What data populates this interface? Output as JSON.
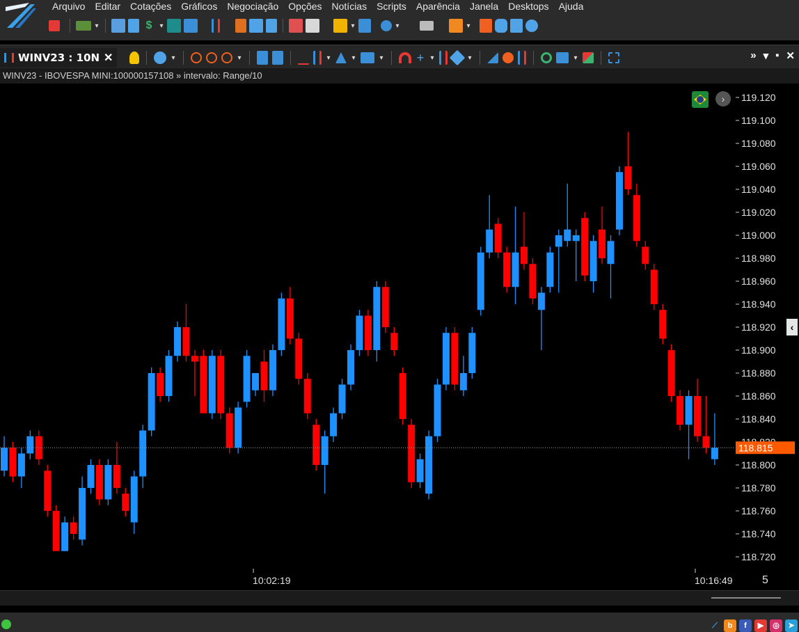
{
  "menu": [
    "Arquivo",
    "Editar",
    "Cotações",
    "Gráficos",
    "Negociação",
    "Opções",
    "Notícias",
    "Scripts",
    "Aparência",
    "Janela",
    "Desktops",
    "Ajuda"
  ],
  "tab": {
    "label": "WINV23 : 10N",
    "close": "✕"
  },
  "info_line": "WINV23 - IBOVESPA MINI:100000157108 » intervalo: Range/10",
  "window_controls": [
    "»",
    "▾",
    "▪",
    "✕"
  ],
  "nav_button": "›",
  "collapse_button": "‹",
  "colors": {
    "up": "#1e90ff",
    "down": "#ff0000",
    "price_tag": "#ff5a00",
    "axis_text": "#e0e0e0",
    "background": "#000000"
  },
  "chart_data": {
    "type": "candlestick",
    "y_axis_ticks": [
      "119.120",
      "119.100",
      "119.080",
      "119.060",
      "119.040",
      "119.020",
      "119.000",
      "118.980",
      "118.960",
      "118.940",
      "118.920",
      "118.900",
      "118.880",
      "118.860",
      "118.840",
      "118.820",
      "118.800",
      "118.780",
      "118.760",
      "118.740",
      "118.720"
    ],
    "ylim": [
      118.71,
      119.125
    ],
    "current_price": "118.815",
    "time_labels": [
      {
        "label": "10:02:19",
        "bar_index": 29
      },
      {
        "label": "10:16:49",
        "bar_index": 80
      }
    ],
    "bar_count_label": "5",
    "candles": [
      {
        "o": 118.795,
        "c": 118.815,
        "h": 118.825,
        "l": 118.79
      },
      {
        "o": 118.815,
        "c": 118.79,
        "h": 118.82,
        "l": 118.785
      },
      {
        "o": 118.79,
        "c": 118.81,
        "h": 118.815,
        "l": 118.78
      },
      {
        "o": 118.81,
        "c": 118.825,
        "h": 118.83,
        "l": 118.805
      },
      {
        "o": 118.825,
        "c": 118.805,
        "h": 118.83,
        "l": 118.8
      },
      {
        "o": 118.795,
        "c": 118.76,
        "h": 118.8,
        "l": 118.755
      },
      {
        "o": 118.76,
        "c": 118.725,
        "h": 118.765,
        "l": 118.725
      },
      {
        "o": 118.725,
        "c": 118.75,
        "h": 118.755,
        "l": 118.725
      },
      {
        "o": 118.75,
        "c": 118.74,
        "h": 118.755,
        "l": 118.735
      },
      {
        "o": 118.735,
        "c": 118.78,
        "h": 118.79,
        "l": 118.73
      },
      {
        "o": 118.78,
        "c": 118.8,
        "h": 118.805,
        "l": 118.775
      },
      {
        "o": 118.8,
        "c": 118.77,
        "h": 118.805,
        "l": 118.765
      },
      {
        "o": 118.77,
        "c": 118.8,
        "h": 118.805,
        "l": 118.765
      },
      {
        "o": 118.8,
        "c": 118.78,
        "h": 118.82,
        "l": 118.775
      },
      {
        "o": 118.775,
        "c": 118.76,
        "h": 118.78,
        "l": 118.755
      },
      {
        "o": 118.75,
        "c": 118.79,
        "h": 118.795,
        "l": 118.74
      },
      {
        "o": 118.79,
        "c": 118.83,
        "h": 118.835,
        "l": 118.78
      },
      {
        "o": 118.83,
        "c": 118.88,
        "h": 118.885,
        "l": 118.825
      },
      {
        "o": 118.88,
        "c": 118.86,
        "h": 118.885,
        "l": 118.855
      },
      {
        "o": 118.86,
        "c": 118.895,
        "h": 118.9,
        "l": 118.855
      },
      {
        "o": 118.895,
        "c": 118.92,
        "h": 118.925,
        "l": 118.89
      },
      {
        "o": 118.92,
        "c": 118.895,
        "h": 118.94,
        "l": 118.89
      },
      {
        "o": 118.895,
        "c": 118.89,
        "h": 118.9,
        "l": 118.86
      },
      {
        "o": 118.895,
        "c": 118.845,
        "h": 118.9,
        "l": 118.845
      },
      {
        "o": 118.845,
        "c": 118.895,
        "h": 118.9,
        "l": 118.84
      },
      {
        "o": 118.895,
        "c": 118.845,
        "h": 118.9,
        "l": 118.84
      },
      {
        "o": 118.845,
        "c": 118.815,
        "h": 118.85,
        "l": 118.81
      },
      {
        "o": 118.815,
        "c": 118.85,
        "h": 118.855,
        "l": 118.81
      },
      {
        "o": 118.855,
        "c": 118.895,
        "h": 118.9,
        "l": 118.85
      },
      {
        "o": 118.865,
        "c": 118.88,
        "h": 118.88,
        "l": 118.86
      },
      {
        "o": 118.89,
        "c": 118.865,
        "h": 118.9,
        "l": 118.855
      },
      {
        "o": 118.865,
        "c": 118.9,
        "h": 118.905,
        "l": 118.86
      },
      {
        "o": 118.9,
        "c": 118.945,
        "h": 118.95,
        "l": 118.895
      },
      {
        "o": 118.945,
        "c": 118.91,
        "h": 118.955,
        "l": 118.905
      },
      {
        "o": 118.91,
        "c": 118.875,
        "h": 118.915,
        "l": 118.87
      },
      {
        "o": 118.875,
        "c": 118.845,
        "h": 118.88,
        "l": 118.84
      },
      {
        "o": 118.835,
        "c": 118.8,
        "h": 118.84,
        "l": 118.795
      },
      {
        "o": 118.8,
        "c": 118.825,
        "h": 118.83,
        "l": 118.775
      },
      {
        "o": 118.825,
        "c": 118.845,
        "h": 118.85,
        "l": 118.82
      },
      {
        "o": 118.845,
        "c": 118.87,
        "h": 118.875,
        "l": 118.84
      },
      {
        "o": 118.87,
        "c": 118.9,
        "h": 118.905,
        "l": 118.865
      },
      {
        "o": 118.9,
        "c": 118.93,
        "h": 118.935,
        "l": 118.895
      },
      {
        "o": 118.93,
        "c": 118.9,
        "h": 118.935,
        "l": 118.895
      },
      {
        "o": 118.9,
        "c": 118.955,
        "h": 118.96,
        "l": 118.89
      },
      {
        "o": 118.955,
        "c": 118.92,
        "h": 118.96,
        "l": 118.915
      },
      {
        "o": 118.915,
        "c": 118.9,
        "h": 118.92,
        "l": 118.895
      },
      {
        "o": 118.88,
        "c": 118.84,
        "h": 118.885,
        "l": 118.835
      },
      {
        "o": 118.835,
        "c": 118.785,
        "h": 118.84,
        "l": 118.78
      },
      {
        "o": 118.785,
        "c": 118.805,
        "h": 118.81,
        "l": 118.78
      },
      {
        "o": 118.775,
        "c": 118.825,
        "h": 118.83,
        "l": 118.77
      },
      {
        "o": 118.825,
        "c": 118.87,
        "h": 118.875,
        "l": 118.82
      },
      {
        "o": 118.87,
        "c": 118.915,
        "h": 118.92,
        "l": 118.865
      },
      {
        "o": 118.915,
        "c": 118.87,
        "h": 118.92,
        "l": 118.865
      },
      {
        "o": 118.865,
        "c": 118.88,
        "h": 118.895,
        "l": 118.86
      },
      {
        "o": 118.88,
        "c": 118.915,
        "h": 118.92,
        "l": 118.875
      },
      {
        "o": 118.935,
        "c": 118.985,
        "h": 118.99,
        "l": 118.93
      },
      {
        "o": 118.985,
        "c": 119.005,
        "h": 119.035,
        "l": 118.98
      },
      {
        "o": 119.01,
        "c": 118.985,
        "h": 119.015,
        "l": 118.98
      },
      {
        "o": 118.985,
        "c": 118.955,
        "h": 118.99,
        "l": 118.95
      },
      {
        "o": 118.955,
        "c": 118.985,
        "h": 119.025,
        "l": 118.94
      },
      {
        "o": 118.99,
        "c": 118.975,
        "h": 119.02,
        "l": 118.97
      },
      {
        "o": 118.975,
        "c": 118.945,
        "h": 118.98,
        "l": 118.94
      },
      {
        "o": 118.935,
        "c": 118.95,
        "h": 118.955,
        "l": 118.9
      },
      {
        "o": 118.955,
        "c": 118.985,
        "h": 118.99,
        "l": 118.95
      },
      {
        "o": 118.99,
        "c": 119.0,
        "h": 119.005,
        "l": 118.95
      },
      {
        "o": 118.995,
        "c": 119.005,
        "h": 119.045,
        "l": 118.99
      },
      {
        "o": 118.995,
        "c": 119.0,
        "h": 119.005,
        "l": 118.96
      },
      {
        "o": 119.015,
        "c": 118.965,
        "h": 119.02,
        "l": 118.96
      },
      {
        "o": 118.96,
        "c": 118.995,
        "h": 119.0,
        "l": 118.95
      },
      {
        "o": 119.005,
        "c": 118.98,
        "h": 119.025,
        "l": 118.975
      },
      {
        "o": 118.975,
        "c": 118.995,
        "h": 119.0,
        "l": 118.945
      },
      {
        "o": 119.005,
        "c": 119.055,
        "h": 119.06,
        "l": 119.0
      },
      {
        "o": 119.06,
        "c": 119.04,
        "h": 119.09,
        "l": 119.035
      },
      {
        "o": 119.035,
        "c": 118.995,
        "h": 119.045,
        "l": 118.99
      },
      {
        "o": 118.99,
        "c": 118.975,
        "h": 118.995,
        "l": 118.97
      },
      {
        "o": 118.97,
        "c": 118.94,
        "h": 118.975,
        "l": 118.935
      },
      {
        "o": 118.935,
        "c": 118.91,
        "h": 118.94,
        "l": 118.905
      },
      {
        "o": 118.9,
        "c": 118.86,
        "h": 118.905,
        "l": 118.855
      },
      {
        "o": 118.86,
        "c": 118.835,
        "h": 118.865,
        "l": 118.83
      },
      {
        "o": 118.835,
        "c": 118.86,
        "h": 118.865,
        "l": 118.805
      },
      {
        "o": 118.86,
        "c": 118.825,
        "h": 118.875,
        "l": 118.82
      },
      {
        "o": 118.825,
        "c": 118.815,
        "h": 118.86,
        "l": 118.81
      },
      {
        "o": 118.805,
        "c": 118.815,
        "h": 118.845,
        "l": 118.8
      }
    ]
  }
}
